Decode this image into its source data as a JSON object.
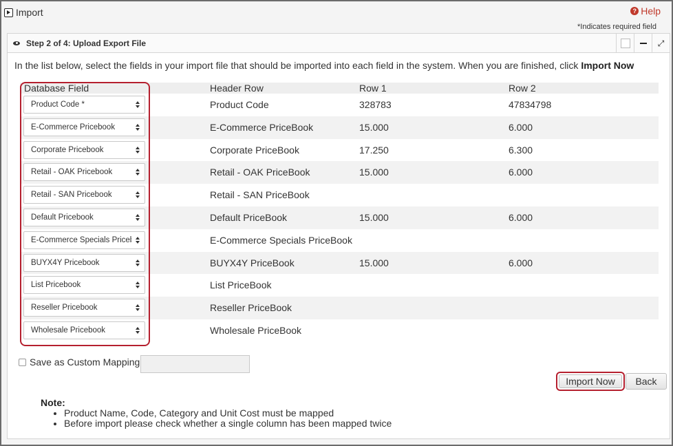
{
  "window": {
    "title": "Import",
    "help_label": "Help",
    "required_note": "*Indicates required field"
  },
  "panel": {
    "title": "Step 2 of 4: Upload Export File"
  },
  "instructions": {
    "text": "In the list below, select the fields in your import file that should be imported into each field in the system. When you are finished, click ",
    "emphasis": "Import Now"
  },
  "table": {
    "headers": {
      "database_field": "Database Field",
      "header_row": "Header Row",
      "row1": "Row 1",
      "row2": "Row 2"
    },
    "rows": [
      {
        "field": "Product Code *",
        "header": "Product Code",
        "row1": "328783",
        "row2": "47834798"
      },
      {
        "field": "E-Commerce Pricebook",
        "header": "E-Commerce PriceBook",
        "row1": "15.000",
        "row2": "6.000"
      },
      {
        "field": "Corporate Pricebook",
        "header": "Corporate PriceBook",
        "row1": "17.250",
        "row2": "6.300"
      },
      {
        "field": "Retail - OAK Pricebook",
        "header": "Retail - OAK PriceBook",
        "row1": "15.000",
        "row2": "6.000"
      },
      {
        "field": "Retail - SAN Pricebook",
        "header": "Retail - SAN PriceBook",
        "row1": "",
        "row2": ""
      },
      {
        "field": "Default Pricebook",
        "header": "Default PriceBook",
        "row1": "15.000",
        "row2": "6.000"
      },
      {
        "field": "E-Commerce Specials Pricebo",
        "header": "E-Commerce Specials PriceBook",
        "row1": "",
        "row2": ""
      },
      {
        "field": "BUYX4Y Pricebook",
        "header": "BUYX4Y PriceBook",
        "row1": "15.000",
        "row2": "6.000"
      },
      {
        "field": "List Pricebook",
        "header": "List PriceBook",
        "row1": "",
        "row2": ""
      },
      {
        "field": "Reseller Pricebook",
        "header": "Reseller PriceBook",
        "row1": "",
        "row2": ""
      },
      {
        "field": "Wholesale Pricebook",
        "header": "Wholesale PriceBook",
        "row1": "",
        "row2": ""
      }
    ]
  },
  "save_mapping": {
    "label": "Save as Custom Mapping:",
    "value": ""
  },
  "buttons": {
    "import_now": "Import Now",
    "back": "Back"
  },
  "note": {
    "title": "Note:",
    "items": [
      "Product Name, Code, Category and Unit Cost must be mapped",
      "Before import please check whether a single column has been mapped twice"
    ]
  },
  "colors": {
    "highlight": "#b51f2e",
    "help": "#c0392b",
    "row_alt": "#f2f2f2"
  },
  "icons": [
    "import-icon",
    "help-icon",
    "eye-icon",
    "maximize-icon",
    "minimize-icon",
    "expand-icon",
    "select-arrows-icon",
    "checkbox"
  ]
}
